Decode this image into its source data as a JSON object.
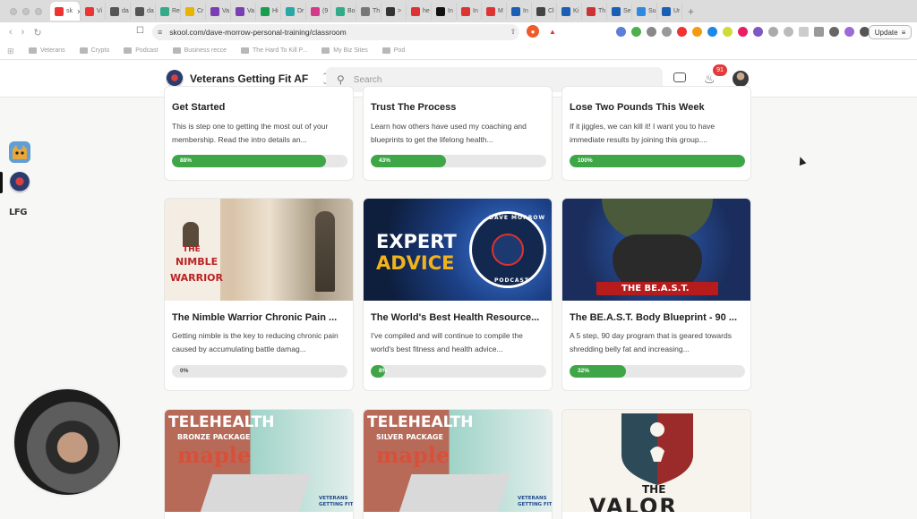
{
  "browser": {
    "url": "skool.com/dave-morrow-personal-training/classroom",
    "update_label": "Update",
    "tabs": [
      {
        "label": "sk",
        "color": "#e33"
      },
      {
        "label": "Vi",
        "color": "#e33"
      },
      {
        "label": "da",
        "color": "#555"
      },
      {
        "label": "da",
        "color": "#555"
      },
      {
        "label": "Re",
        "color": "#3a8"
      },
      {
        "label": "Cr",
        "color": "#e8b400"
      },
      {
        "label": "Va",
        "color": "#7b3fb5"
      },
      {
        "label": "Va",
        "color": "#7b3fb5"
      },
      {
        "label": "Hi",
        "color": "#1a9d4f"
      },
      {
        "label": "Dr",
        "color": "#2aa8a8"
      },
      {
        "label": "(9",
        "color": "#d33a8c"
      },
      {
        "label": "Bo",
        "color": "#3a8"
      },
      {
        "label": "Th",
        "color": "#777"
      },
      {
        "label": ">",
        "color": "#333"
      },
      {
        "label": "he",
        "color": "#d33"
      },
      {
        "label": "In",
        "color": "#111"
      },
      {
        "label": "In",
        "color": "#d33"
      },
      {
        "label": "M",
        "color": "#d33"
      },
      {
        "label": "In",
        "color": "#1a5fb4"
      },
      {
        "label": "Cl",
        "color": "#444"
      },
      {
        "label": "Ki",
        "color": "#1a5fb4"
      },
      {
        "label": "Th",
        "color": "#c33"
      },
      {
        "label": "Se",
        "color": "#1a5fb4"
      },
      {
        "label": "Su",
        "color": "#2d8ae0"
      },
      {
        "label": "Ur",
        "color": "#1a5fb4"
      }
    ],
    "bookmarks": [
      "Veterans",
      "Crypto",
      "Podcast",
      "Business recce",
      "The Hard To Kill P...",
      "My Biz Sites",
      "Pod"
    ]
  },
  "header": {
    "community_name": "Veterans Getting Fit AF",
    "search_placeholder": "Search",
    "notification_count": "91"
  },
  "rail": {
    "lfg_label": "LFG"
  },
  "courses": [
    {
      "title": "Get Started",
      "desc": "This is step one to getting the most out of your membership. Read the intro details an...",
      "progress_label": "88%",
      "progress": 0.88
    },
    {
      "title": "Trust The Process",
      "desc": "Learn how others have used my coaching and blueprints to get the lifelong health...",
      "progress_label": "43%",
      "progress": 0.43
    },
    {
      "title": "Lose Two Pounds This Week",
      "desc": "If it jiggles, we can kill it! I want you to have immediate results by joining this group....",
      "progress_label": "100%",
      "progress": 1.0
    },
    {
      "title": "The Nimble Warrior Chronic Pain ...",
      "desc": "Getting nimble is the key to reducing chronic pain caused by accumulating battle damag...",
      "progress_label": "0%",
      "progress": 0.0,
      "thumb_text": [
        "THE",
        "NIMBLE",
        "WARRIOR"
      ]
    },
    {
      "title": "The World's Best Health Resource...",
      "desc": "I've compiled and will continue to compile the world's best fitness and health advice...",
      "progress_label": "8%",
      "progress": 0.08,
      "thumb_text": [
        "EXPERT",
        "ADVICE",
        "DAVE MORROW",
        "PODCAST"
      ]
    },
    {
      "title": "The BE.A.S.T. Body Blueprint - 90 ...",
      "desc": "A 5 step, 90 day program that is geared towards shredding belly fat and increasing...",
      "progress_label": "32%",
      "progress": 0.32,
      "thumb_text": [
        "THE BE.A.S.T."
      ]
    },
    {
      "thumb_text": [
        "TELEHEALTH",
        "BRONZE PACKAGE",
        "maple",
        "VETERANS",
        "GETTING FIT"
      ]
    },
    {
      "thumb_text": [
        "TELEHEALTH",
        "SILVER PACKAGE",
        "maple",
        "VETERANS",
        "GETTING FIT"
      ]
    },
    {
      "thumb_text": [
        "THE",
        "VALOR"
      ]
    }
  ],
  "colors": {
    "progress_fill": "#3fa648",
    "progress_track": "#e7e7e7",
    "notification": "#e23b3b"
  }
}
